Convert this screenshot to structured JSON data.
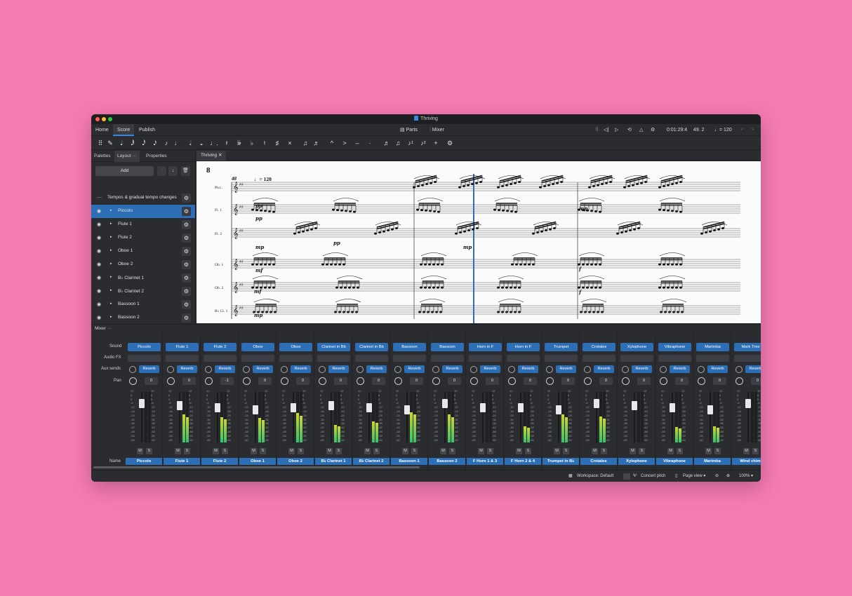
{
  "window": {
    "title": "Thriving"
  },
  "menu": {
    "tabs": [
      "Home",
      "Score",
      "Publish"
    ],
    "parts_label": "Parts",
    "mixer_label": "Mixer",
    "time": "0:01:29:4",
    "position": "49. 2",
    "tempo": "♩= 120"
  },
  "note_toolbar": [
    "⠿",
    "✎",
    "𝅘𝅥",
    "𝅘𝅥𝅱",
    "𝅘𝅥𝅰",
    "𝅘𝅥𝅯",
    "♪",
    "♩",
    "𝅗𝅥",
    "𝅝",
    "♩.",
    "𝄽",
    "𝄫",
    "♭",
    "♮",
    "♯",
    "×",
    "♫",
    "♬",
    "^",
    ">",
    "–",
    "·",
    "♬",
    "♫",
    "♪¹",
    "♪²",
    "+",
    "⚙"
  ],
  "left_panel": {
    "tabs": [
      "Palettes",
      "Layout",
      "Properties"
    ],
    "add_label": "Add",
    "tempo_row": "Tempos & gradual tempo changes",
    "layers": [
      "Piccolo",
      "Flute 1",
      "Flute 2",
      "Oboe 1",
      "Oboe 2",
      "B♭ Clarinet 1",
      "B♭ Clarinet 2",
      "Bassoon 1",
      "Bassoon 2",
      "F Horn 1 & 3"
    ]
  },
  "score": {
    "tab": "Thriving",
    "measure": "8",
    "rehearsal": "48",
    "tempo": "♩= 120",
    "staves": [
      "Picc.",
      "Fl. 1",
      "Fl. 2",
      "Ob. 1",
      "Ob. 2",
      "B♭ Cl. 1"
    ],
    "dynamics": [
      "pp",
      "pp",
      "mp",
      "mf",
      "mf",
      "mp",
      "mp",
      "pp",
      "mp",
      "f",
      "f"
    ]
  },
  "mixer": {
    "title": "Mixer",
    "row_labels": {
      "sound": "Sound",
      "audio_fx": "Audio FX",
      "aux": "Aux sends",
      "pan": "Pan",
      "name": "Name"
    },
    "aux_label": "Reverb",
    "mute": "M",
    "solo": "S",
    "scale_labels": [
      "12",
      "6",
      "0",
      "-6",
      "-12",
      "-18",
      "-24",
      "-30",
      "-36",
      "-42",
      "-48",
      "-54",
      "-60"
    ],
    "channels": [
      {
        "sound": "Piccolo",
        "name": "Piccolo",
        "pan": "0",
        "level": 0
      },
      {
        "sound": "Flute 1",
        "name": "Flute 1",
        "pan": "0",
        "level": 0.55
      },
      {
        "sound": "Flute 2",
        "name": "Flute 2",
        "pan": "-1",
        "level": 0.5
      },
      {
        "sound": "Oboe",
        "name": "Oboe 1",
        "pan": "0",
        "level": 0.48
      },
      {
        "sound": "Oboe",
        "name": "Oboe 2",
        "pan": "0",
        "level": 0.58
      },
      {
        "sound": "Clarinet in Bb",
        "name": "B♭ Clarinet 1",
        "pan": "0",
        "level": 0.35
      },
      {
        "sound": "Clarinet in Bb",
        "name": "B♭ Clarinet 2",
        "pan": "0",
        "level": 0.42
      },
      {
        "sound": "Bassoon",
        "name": "Bassoon 1",
        "pan": "0",
        "level": 0.6
      },
      {
        "sound": "Bassoon",
        "name": "Bassoon 2",
        "pan": "0",
        "level": 0.55
      },
      {
        "sound": "Horn in F",
        "name": "F Horn 1 & 3",
        "pan": "0",
        "level": 0
      },
      {
        "sound": "Horn in F",
        "name": "F Horn 2 & 4",
        "pan": "0",
        "level": 0.32
      },
      {
        "sound": "Trumpet",
        "name": "Trumpet in B♭",
        "pan": "0",
        "level": 0.55
      },
      {
        "sound": "Crotales",
        "name": "Crotales",
        "pan": "0",
        "level": 0.52
      },
      {
        "sound": "Xylophone",
        "name": "Xylophone",
        "pan": "0",
        "level": 0
      },
      {
        "sound": "Vibraphone",
        "name": "Vibraphone",
        "pan": "0",
        "level": 0.3
      },
      {
        "sound": "Marimba",
        "name": "Marimba",
        "pan": "0",
        "level": 0.32
      },
      {
        "sound": "Mark Tree",
        "name": "Wind chim",
        "pan": "0",
        "level": 0
      }
    ]
  },
  "status": {
    "workspace": "Workspace: Default",
    "concert_pitch": "Concert pitch",
    "view": "Page view",
    "zoom": "100%"
  },
  "colors": {
    "accent": "#2c6fb7",
    "background": "#f67bb3",
    "panel": "#2b2c30"
  }
}
